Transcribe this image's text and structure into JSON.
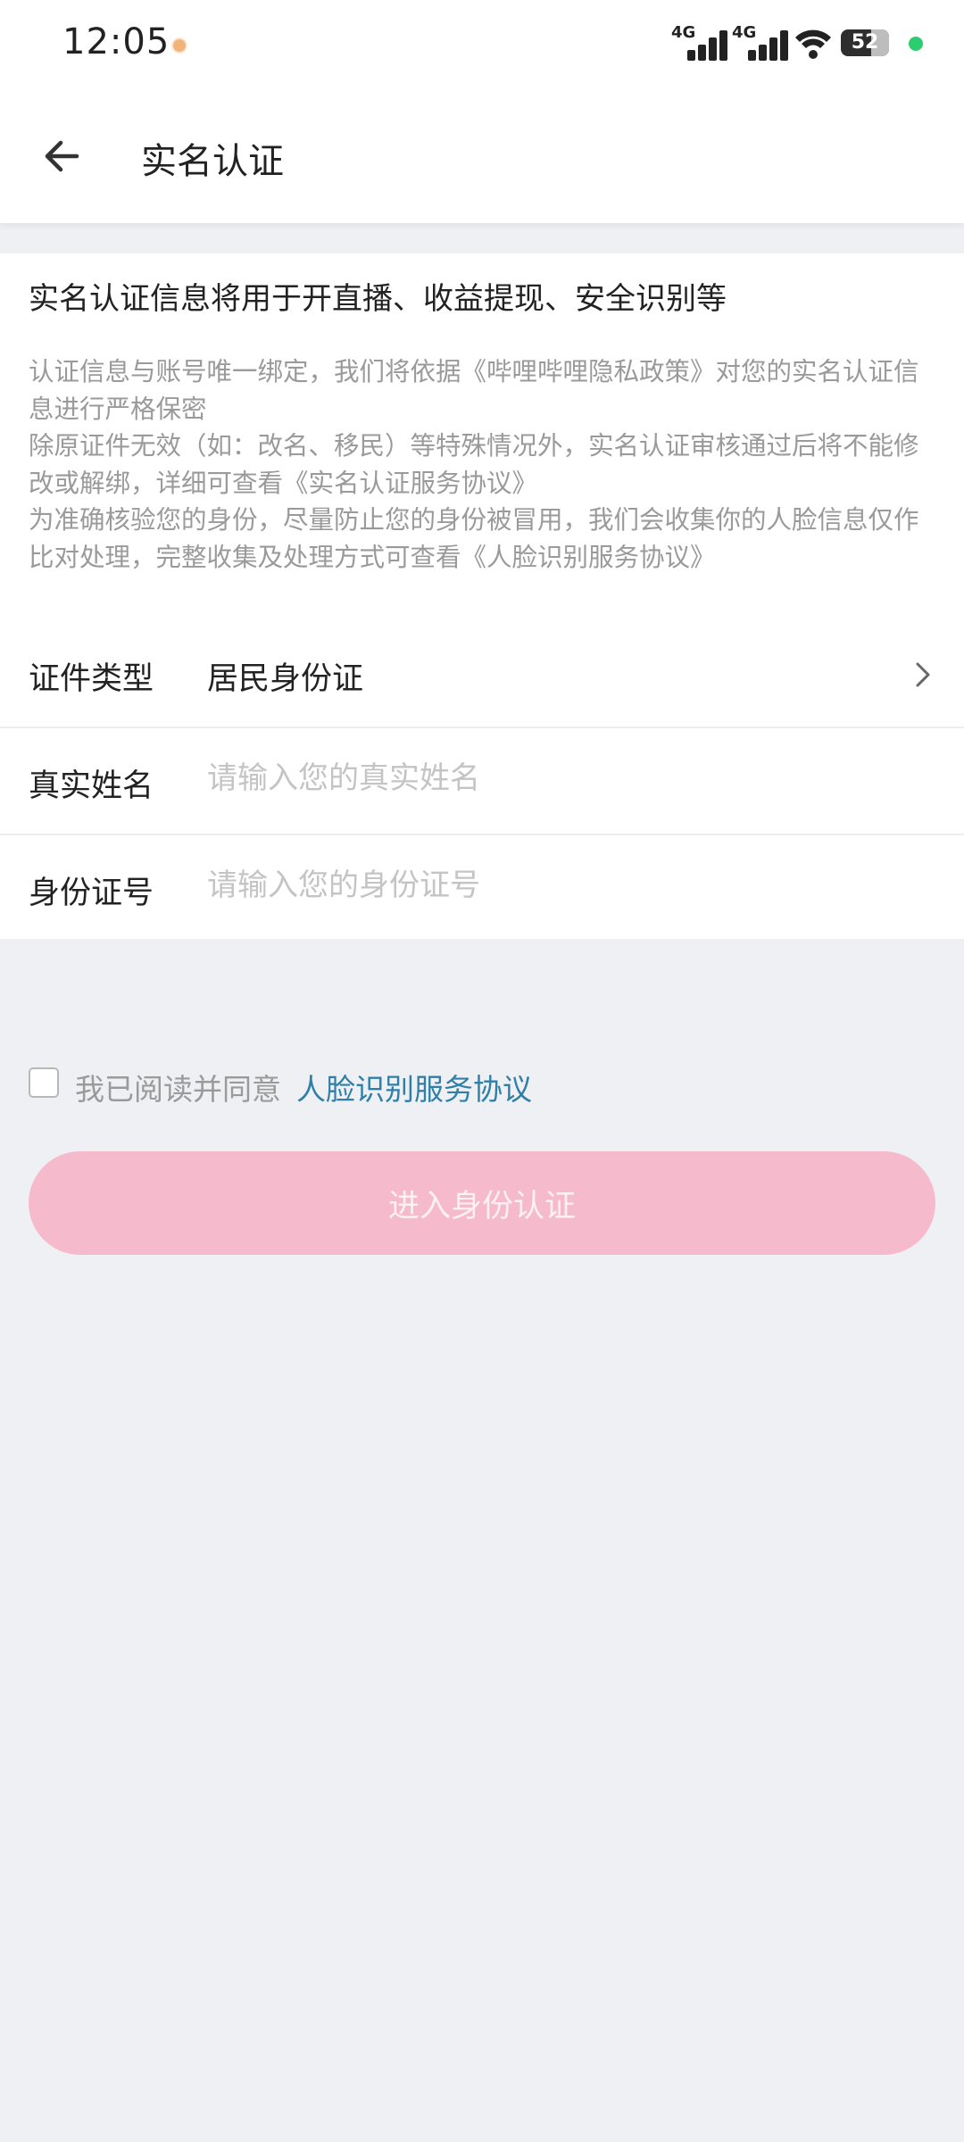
{
  "status_bar": {
    "time": "12:05",
    "signal_1": "4G",
    "signal_2": "4G",
    "battery": "52",
    "icons": [
      "notification-dot-icon",
      "signal-icon",
      "wifi-icon",
      "battery-icon",
      "camera-indicator-dot"
    ]
  },
  "header": {
    "back_icon": "arrow-left-icon",
    "title": "实名认证"
  },
  "intro": {
    "headline": "实名认证信息将用于开直播、收益提现、安全识别等",
    "notes": [
      "认证信息与账号唯一绑定，我们将依据《哔哩哔哩隐私政策》对您的实名认证信息进行严格保密",
      "除原证件无效（如：改名、移民）等特殊情况外，实名认证审核通过后将不能修改或解绑，详细可查看《实名认证服务协议》",
      "为准确核验您的身份，尽量防止您的身份被冒用，我们会收集你的人脸信息仅作比对处理，完整收集及处理方式可查看《人脸识别服务协议》"
    ]
  },
  "form": {
    "id_type": {
      "label": "证件类型",
      "value": "居民身份证",
      "icon": "chevron-right-icon"
    },
    "real_name": {
      "label": "真实姓名",
      "value": "",
      "placeholder": "请输入您的真实姓名"
    },
    "id_number": {
      "label": "身份证号",
      "value": "",
      "placeholder": "请输入您的身份证号"
    }
  },
  "agreement": {
    "checked": false,
    "text": "我已阅读并同意",
    "link": "人脸识别服务协议"
  },
  "submit": {
    "label": "进入身份认证",
    "enabled": false
  },
  "colors": {
    "background": "#eef0f4",
    "link": "#2f7fa8",
    "button_disabled": "#f6bacd",
    "muted_text": "#9a9a9a"
  }
}
